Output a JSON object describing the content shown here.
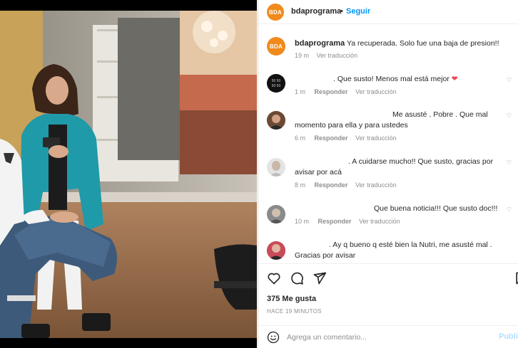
{
  "post": {
    "account": "bdaprograma",
    "follow_label": "Seguir",
    "logo_text": "BDA",
    "caption": "Ya recuperada. Solo fue una baja de presion!!",
    "caption_time": "19 m",
    "translate_label": "Ver traducción",
    "reply_label": "Responder",
    "likes": "375 Me gusta",
    "posted_ago": "HACE 19 MINUTOS",
    "comment_placeholder": "Agrega un comentario...",
    "publish_label": "Publi"
  },
  "comments": [
    {
      "text": ". Que susto! Menos mal está mejor",
      "emoji": "❤",
      "time": "1 m"
    },
    {
      "text_line1": "Me asusté . Pobre . Que mal",
      "text_line2": "momento para ella y para ustedes",
      "time": "6 m"
    },
    {
      "text_line1": ". A cuidarse mucho!! Que susto, gracias por",
      "text_line2": "avisar por acá",
      "time": "8 m"
    },
    {
      "text": "Que buena noticia!!! Que susto doc!!!",
      "time": "10 m"
    },
    {
      "text_line1": ". Ay q bueno q esté bien la Nutri, me asusté mal .",
      "text_line2": "Gracias por avisar"
    }
  ],
  "icons": {
    "heart": "heart-icon",
    "comment": "comment-icon",
    "share": "share-icon",
    "bookmark": "bookmark-icon",
    "emoji": "emoji-icon"
  },
  "colors": {
    "accent_blue": "#0095f6",
    "logo_orange": "#f08a1c",
    "heart_red": "#ed4956"
  }
}
